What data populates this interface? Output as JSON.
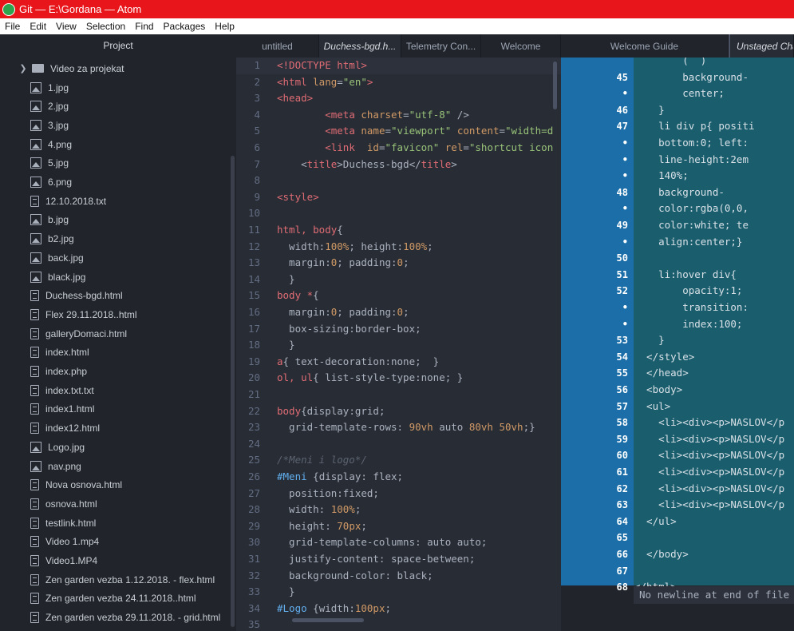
{
  "window": {
    "title": "Git — E:\\Gordana — Atom"
  },
  "menu": [
    "File",
    "Edit",
    "View",
    "Selection",
    "Find",
    "Packages",
    "Help"
  ],
  "tree": {
    "header": "Project",
    "folder": "Video za projekat",
    "files": [
      {
        "name": "1.jpg",
        "icon": "image-icon"
      },
      {
        "name": "2.jpg",
        "icon": "image-icon"
      },
      {
        "name": "3.jpg",
        "icon": "image-icon"
      },
      {
        "name": "4.png",
        "icon": "image-icon"
      },
      {
        "name": "5.jpg",
        "icon": "image-icon"
      },
      {
        "name": "6.png",
        "icon": "image-icon"
      },
      {
        "name": "12.10.2018.txt",
        "icon": "file-icon"
      },
      {
        "name": "b.jpg",
        "icon": "image-icon"
      },
      {
        "name": "b2.jpg",
        "icon": "image-icon"
      },
      {
        "name": "back.jpg",
        "icon": "image-icon"
      },
      {
        "name": "black.jpg",
        "icon": "image-icon"
      },
      {
        "name": "Duchess-bgd.html",
        "icon": "file-icon"
      },
      {
        "name": "Flex 29.11.2018..html",
        "icon": "file-icon"
      },
      {
        "name": "galleryDomaci.html",
        "icon": "file-icon"
      },
      {
        "name": "index.html",
        "icon": "file-icon"
      },
      {
        "name": "index.php",
        "icon": "file-icon"
      },
      {
        "name": "index.txt.txt",
        "icon": "file-icon"
      },
      {
        "name": "index1.html",
        "icon": "file-icon"
      },
      {
        "name": "index12.html",
        "icon": "file-icon"
      },
      {
        "name": "Logo.jpg",
        "icon": "image-icon"
      },
      {
        "name": "nav.png",
        "icon": "image-icon"
      },
      {
        "name": "Nova osnova.html",
        "icon": "file-icon"
      },
      {
        "name": "osnova.html",
        "icon": "file-icon"
      },
      {
        "name": "testlink.html",
        "icon": "file-icon"
      },
      {
        "name": "Video 1.mp4",
        "icon": "file-icon"
      },
      {
        "name": "Video1.MP4",
        "icon": "file-icon"
      },
      {
        "name": "Zen garden vezba 1.12.2018. - flex.html",
        "icon": "file-icon"
      },
      {
        "name": "Zen garden vezba 24.11.2018..html",
        "icon": "file-icon"
      },
      {
        "name": "Zen garden vezba 29.11.2018. - grid.html",
        "icon": "file-icon"
      }
    ]
  },
  "tabs_left": [
    "untitled",
    "Duchess-bgd.h...",
    "Telemetry Con...",
    "Welcome"
  ],
  "tabs_right": [
    "Welcome Guide",
    "Unstaged Cha"
  ],
  "left_lines": [
    [
      [
        "t-tag",
        "<!DOCTYPE html>"
      ]
    ],
    [
      [
        "t-tag",
        "<html "
      ],
      [
        "t-attr",
        "lang"
      ],
      [
        "",
        "="
      ],
      [
        "t-str",
        "\"en\""
      ],
      [
        "t-tag",
        ">"
      ]
    ],
    [
      [
        "t-tag",
        "<head>"
      ]
    ],
    [
      [
        "",
        "        "
      ],
      [
        "t-tag",
        "<meta "
      ],
      [
        "t-attr",
        "charset"
      ],
      [
        "",
        "="
      ],
      [
        "t-str",
        "\"utf-8\""
      ],
      [
        "",
        " />"
      ]
    ],
    [
      [
        "",
        "        "
      ],
      [
        "t-tag",
        "<meta "
      ],
      [
        "t-attr",
        "name"
      ],
      [
        "",
        "="
      ],
      [
        "t-str",
        "\"viewport\""
      ],
      [
        "",
        " "
      ],
      [
        "t-attr",
        "content"
      ],
      [
        "",
        "="
      ],
      [
        "t-str",
        "\"width=d"
      ]
    ],
    [
      [
        "",
        "        "
      ],
      [
        "t-tag",
        "<link  "
      ],
      [
        "t-attr",
        "id"
      ],
      [
        "",
        "="
      ],
      [
        "t-str",
        "\"favicon\""
      ],
      [
        "",
        " "
      ],
      [
        "t-attr",
        "rel"
      ],
      [
        "",
        "="
      ],
      [
        "t-str",
        "\"shortcut icon"
      ]
    ],
    [
      [
        "",
        "    <"
      ],
      [
        "t-tag",
        "title"
      ],
      [
        "",
        ">Duchess-bgd</"
      ],
      [
        "t-tag",
        "title"
      ],
      [
        "",
        ">"
      ]
    ],
    [
      [
        "",
        ""
      ]
    ],
    [
      [
        "t-tag",
        "<style>"
      ]
    ],
    [
      [
        "",
        ""
      ]
    ],
    [
      [
        "t-sel",
        "html, body"
      ],
      [
        "",
        "{"
      ]
    ],
    [
      [
        "",
        "  width:"
      ],
      [
        "t-num",
        "100%"
      ],
      [
        "",
        "; height:"
      ],
      [
        "t-num",
        "100%"
      ],
      [
        "",
        ";"
      ]
    ],
    [
      [
        "",
        "  margin:"
      ],
      [
        "t-num",
        "0"
      ],
      [
        "",
        "; padding:"
      ],
      [
        "t-num",
        "0"
      ],
      [
        "",
        ";"
      ]
    ],
    [
      [
        "",
        "  }"
      ]
    ],
    [
      [
        "t-sel",
        "body *"
      ],
      [
        "",
        "{"
      ]
    ],
    [
      [
        "",
        "  margin:"
      ],
      [
        "t-num",
        "0"
      ],
      [
        "",
        "; padding:"
      ],
      [
        "t-num",
        "0"
      ],
      [
        "",
        ";"
      ]
    ],
    [
      [
        "",
        "  box-sizing:border-box;"
      ]
    ],
    [
      [
        "",
        "  }"
      ]
    ],
    [
      [
        "t-sel",
        "a"
      ],
      [
        "",
        "{ text-decoration:none;  }"
      ]
    ],
    [
      [
        "t-sel",
        "ol, ul"
      ],
      [
        "",
        "{ list-style-type:none; }"
      ]
    ],
    [
      [
        "",
        ""
      ]
    ],
    [
      [
        "t-sel",
        "body"
      ],
      [
        "",
        "{display:grid;"
      ]
    ],
    [
      [
        "",
        "  grid-template-rows: "
      ],
      [
        "t-num",
        "90vh"
      ],
      [
        "",
        " auto "
      ],
      [
        "t-num",
        "80vh"
      ],
      [
        "",
        " "
      ],
      [
        "t-num",
        "50vh"
      ],
      [
        "",
        ";}"
      ]
    ],
    [
      [
        "",
        ""
      ]
    ],
    [
      [
        "t-cmt",
        "/*Meni i logo*/"
      ]
    ],
    [
      [
        "t-id",
        "#Meni"
      ],
      [
        "",
        " {display: flex;"
      ]
    ],
    [
      [
        "",
        "  position:fixed;"
      ]
    ],
    [
      [
        "",
        "  width: "
      ],
      [
        "t-num",
        "100%"
      ],
      [
        "",
        ";"
      ]
    ],
    [
      [
        "",
        "  height: "
      ],
      [
        "t-num",
        "70px"
      ],
      [
        "",
        ";"
      ]
    ],
    [
      [
        "",
        "  grid-template-columns: auto auto;"
      ]
    ],
    [
      [
        "",
        "  justify-content: space-between;"
      ]
    ],
    [
      [
        "",
        "  background-color: black;"
      ]
    ],
    [
      [
        "",
        "  }"
      ]
    ],
    [
      [
        "t-id",
        "#Logo"
      ],
      [
        "",
        " {width:"
      ],
      [
        "t-num",
        "100px"
      ],
      [
        "",
        ";"
      ]
    ],
    [
      [
        "",
        ""
      ]
    ]
  ],
  "right_lines": [
    {
      "n": "",
      "t": "        (  )"
    },
    {
      "n": "45",
      "t": "        background-"
    },
    {
      "n": "•",
      "t": "        center;"
    },
    {
      "n": "46",
      "t": "    }"
    },
    {
      "n": "47",
      "t": "    li div p{ positi"
    },
    {
      "n": "•",
      "t": "    bottom:0; left:"
    },
    {
      "n": "•",
      "t": "    line-height:2em"
    },
    {
      "n": "•",
      "t": "    140%;"
    },
    {
      "n": "48",
      "t": "    background-"
    },
    {
      "n": "•",
      "t": "    color:rgba(0,0,"
    },
    {
      "n": "49",
      "t": "    color:white; te"
    },
    {
      "n": "•",
      "t": "    align:center;}"
    },
    {
      "n": "50",
      "t": ""
    },
    {
      "n": "51",
      "t": "    li:hover div{"
    },
    {
      "n": "52",
      "t": "        opacity:1;"
    },
    {
      "n": "•",
      "t": "        transition:"
    },
    {
      "n": "•",
      "t": "        index:100;"
    },
    {
      "n": "53",
      "t": "    }"
    },
    {
      "n": "54",
      "t": "  </style>"
    },
    {
      "n": "55",
      "t": "  </head>"
    },
    {
      "n": "56",
      "t": "  <body>"
    },
    {
      "n": "57",
      "t": "  <ul>"
    },
    {
      "n": "58",
      "t": "    <li><div><p>NASLOV</p"
    },
    {
      "n": "59",
      "t": "    <li><div><p>NASLOV</p"
    },
    {
      "n": "60",
      "t": "    <li><div><p>NASLOV</p"
    },
    {
      "n": "61",
      "t": "    <li><div><p>NASLOV</p"
    },
    {
      "n": "62",
      "t": "    <li><div><p>NASLOV</p"
    },
    {
      "n": "63",
      "t": "    <li><div><p>NASLOV</p"
    },
    {
      "n": "64",
      "t": "  </ul>"
    },
    {
      "n": "65",
      "t": ""
    },
    {
      "n": "66",
      "t": "  </body>"
    },
    {
      "n": "67",
      "t": ""
    },
    {
      "n": "68",
      "t": "</html>"
    }
  ],
  "no_newline": "No newline at end of file"
}
